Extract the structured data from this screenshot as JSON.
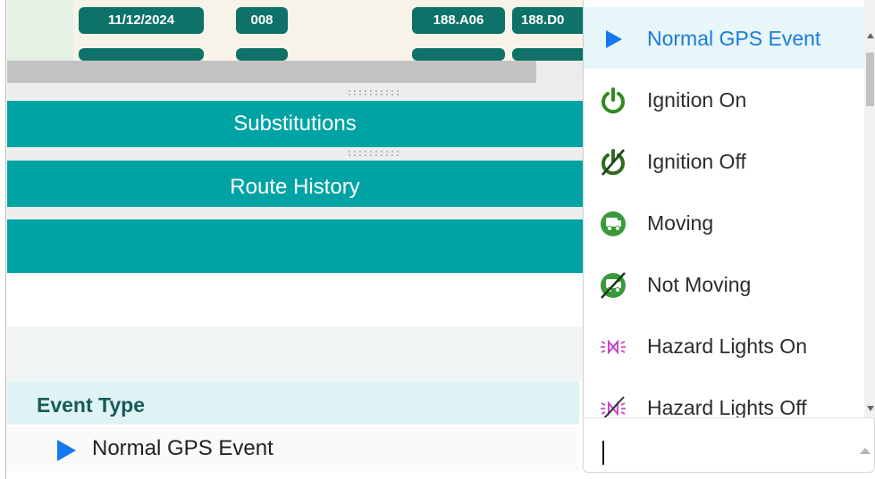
{
  "schedule_row": {
    "date_pill": "11/12/2024",
    "route_pill": "008",
    "stop_pill_1": "188.A06",
    "stop_pill_2": "188.D0"
  },
  "panels": {
    "substitutions_label": "Substitutions",
    "route_history_label": "Route History",
    "third_bar_label": ""
  },
  "event_type": {
    "header": "Event Type",
    "selected_value": "Normal GPS Event"
  },
  "dropdown": {
    "options": [
      {
        "label": "Normal GPS Event",
        "icon": "play-triangle-icon",
        "color": "#1478f0",
        "selected": true
      },
      {
        "label": "Ignition On",
        "icon": "power-icon",
        "color": "#2f8a1f",
        "selected": false
      },
      {
        "label": "Ignition Off",
        "icon": "power-off-icon",
        "color": "#2f6a1f",
        "selected": false
      },
      {
        "label": "Moving",
        "icon": "vehicle-moving-icon",
        "color": "#3a9a3a",
        "selected": false
      },
      {
        "label": "Not Moving",
        "icon": "vehicle-not-moving-icon",
        "color": "#3a9a3a",
        "selected": false
      },
      {
        "label": "Hazard Lights On",
        "icon": "hazard-lights-icon",
        "color": "#c33cc3",
        "selected": false
      },
      {
        "label": "Hazard Lights Off",
        "icon": "hazard-lights-off-icon",
        "color": "#c33cc3",
        "selected": false
      }
    ],
    "search_value": ""
  },
  "colors": {
    "teal": "#00a3a4",
    "dark_teal": "#0e7268",
    "accent_blue": "#1478f0"
  }
}
